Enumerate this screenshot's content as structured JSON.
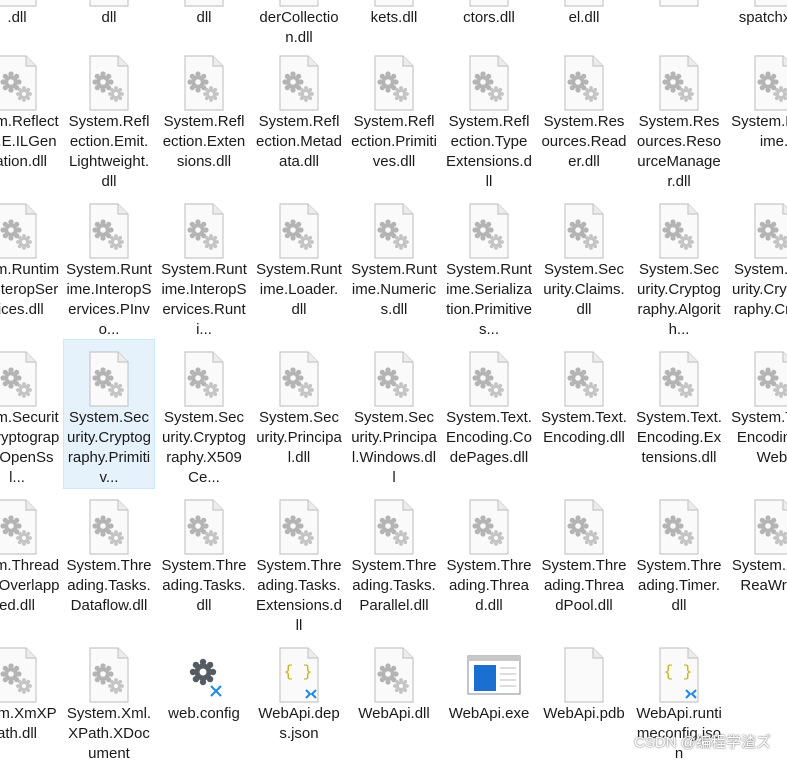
{
  "window": {
    "view": "Explorer large icons"
  },
  "rows": [
    {
      "items": [
        {
          "label": ".dll",
          "icon": "dll-file-icon"
        },
        {
          "label": "dll",
          "icon": "dll-file-icon"
        },
        {
          "label": "dll",
          "icon": "dll-file-icon"
        },
        {
          "label": "derCollection.dll",
          "icon": "dll-file-icon"
        },
        {
          "label": "kets.dll",
          "icon": "dll-file-icon"
        },
        {
          "label": "ctors.dll",
          "icon": "dll-file-icon"
        },
        {
          "label": "el.dll",
          "icon": "dll-file-icon"
        },
        {
          "label": "",
          "icon": "dll-file-icon"
        },
        {
          "label": "spatchxy.d",
          "icon": "dll-file-icon"
        }
      ]
    },
    {
      "items": [
        {
          "label": "stem.Reflection.E.ILGeneation.dll",
          "icon": "dll-file-icon"
        },
        {
          "label": "System.Reflection.Emit.Lightweight.dll",
          "icon": "dll-file-icon"
        },
        {
          "label": "System.Reflection.Extensions.dll",
          "icon": "dll-file-icon"
        },
        {
          "label": "System.Reflection.Metadata.dll",
          "icon": "dll-file-icon"
        },
        {
          "label": "System.Reflection.Primitives.dll",
          "icon": "dll-file-icon"
        },
        {
          "label": "System.Reflection.TypeExtensions.dll",
          "icon": "dll-file-icon"
        },
        {
          "label": "System.Resources.Reader.dll",
          "icon": "dll-file-icon"
        },
        {
          "label": "System.Resources.ResourceManager.dll",
          "icon": "dll-file-icon"
        },
        {
          "label": "System.Runtime.",
          "icon": "dll-file-icon"
        }
      ]
    },
    {
      "items": [
        {
          "label": "stem.Runtime.InteropServices.dll",
          "icon": "dll-file-icon"
        },
        {
          "label": "System.Runtime.InteropServices.PInvo...",
          "icon": "dll-file-icon"
        },
        {
          "label": "System.Runtime.InteropServices.Runti...",
          "icon": "dll-file-icon"
        },
        {
          "label": "System.Runtime.Loader.dll",
          "icon": "dll-file-icon"
        },
        {
          "label": "System.Runtime.Numerics.dll",
          "icon": "dll-file-icon"
        },
        {
          "label": "System.Runtime.Serialization.Primitives...",
          "icon": "dll-file-icon"
        },
        {
          "label": "System.Security.Claims.dll",
          "icon": "dll-file-icon"
        },
        {
          "label": "System.Security.Cryptography.Algorith...",
          "icon": "dll-file-icon"
        },
        {
          "label": "System.Security.Cryptography.Cng.d",
          "icon": "dll-file-icon"
        }
      ]
    },
    {
      "items": [
        {
          "label": "stem.Security.Cryptography.OpenSsl...",
          "icon": "dll-file-icon"
        },
        {
          "label": "System.Security.Cryptography.Primitiv...",
          "icon": "dll-file-icon",
          "selected": true
        },
        {
          "label": "System.Security.Cryptography.X509Ce...",
          "icon": "dll-file-icon"
        },
        {
          "label": "System.Security.Principal.dll",
          "icon": "dll-file-icon"
        },
        {
          "label": "System.Security.Principal.Windows.dll",
          "icon": "dll-file-icon"
        },
        {
          "label": "System.Text.Encoding.CodePages.dll",
          "icon": "dll-file-icon"
        },
        {
          "label": "System.Text.Encoding.dll",
          "icon": "dll-file-icon"
        },
        {
          "label": "System.Text.Encoding.Extensions.dll",
          "icon": "dll-file-icon"
        },
        {
          "label": "System.Text.Encodings.Web.",
          "icon": "dll-file-icon"
        }
      ]
    },
    {
      "items": [
        {
          "label": "stem.Threading.Overlapped.dll",
          "icon": "dll-file-icon"
        },
        {
          "label": "System.Threading.Tasks.Dataflow.dll",
          "icon": "dll-file-icon"
        },
        {
          "label": "System.Threading.Tasks.dll",
          "icon": "dll-file-icon"
        },
        {
          "label": "System.Threading.Tasks.Extensions.dll",
          "icon": "dll-file-icon"
        },
        {
          "label": "System.Threading.Tasks.Parallel.dll",
          "icon": "dll-file-icon"
        },
        {
          "label": "System.Threading.Thread.dll",
          "icon": "dll-file-icon"
        },
        {
          "label": "System.Threading.ThreadPool.dll",
          "icon": "dll-file-icon"
        },
        {
          "label": "System.Threading.Timer.dll",
          "icon": "dll-file-icon"
        },
        {
          "label": "System.Xml.ReaWriter",
          "icon": "dll-file-icon"
        }
      ]
    },
    {
      "items": [
        {
          "label": "stem.XmXPath.dll",
          "icon": "dll-file-icon"
        },
        {
          "label": "System.Xml.XPath.XDocument",
          "icon": "dll-file-icon"
        },
        {
          "label": "web.config",
          "icon": "config-file-icon"
        },
        {
          "label": "WebApi.deps.json",
          "icon": "json-file-icon"
        },
        {
          "label": "WebApi.dll",
          "icon": "dll-file-icon"
        },
        {
          "label": "WebApi.exe",
          "icon": "exe-file-icon"
        },
        {
          "label": "WebApi.pdb",
          "icon": "blank-file-icon"
        },
        {
          "label": "WebApi.runtimeconfig.json",
          "icon": "json-file-icon"
        },
        {
          "label": "",
          "icon": "none"
        }
      ]
    }
  ],
  "watermark": "CSDN @编程学渣ズ"
}
